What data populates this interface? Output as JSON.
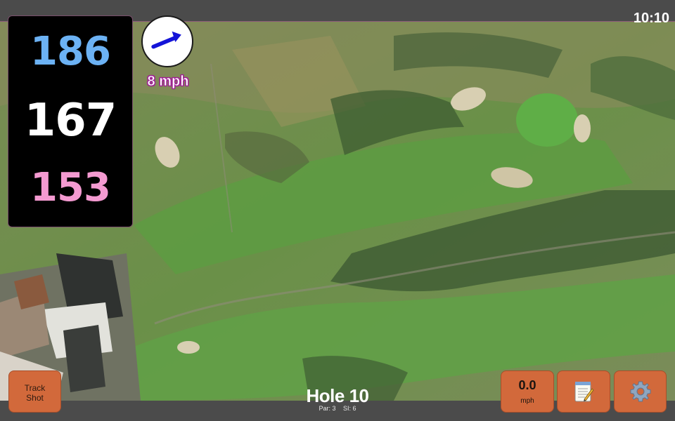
{
  "status_bar": {
    "time": "10:10"
  },
  "yardages": {
    "back": "186",
    "middle": "167",
    "front": "153",
    "colors": {
      "back": "#6cb2f4",
      "middle": "#ffffff",
      "front": "#f49ad1"
    }
  },
  "wind": {
    "speed_label": "8 mph",
    "direction_icon": "wind-arrow-icon"
  },
  "hole": {
    "title": "Hole 10",
    "par": "Par: 3",
    "stroke_index": "SI: 6"
  },
  "buttons": {
    "track_shot_line1": "Track",
    "track_shot_line2": "Shot",
    "speed_value": "0.0",
    "speed_unit": "mph",
    "notes_icon": "notepad-icon",
    "settings_icon": "gear-icon"
  },
  "colors": {
    "button_bg": "#d2693b",
    "bar_bg": "#4b4b4b",
    "panel_bg": "#000000"
  }
}
